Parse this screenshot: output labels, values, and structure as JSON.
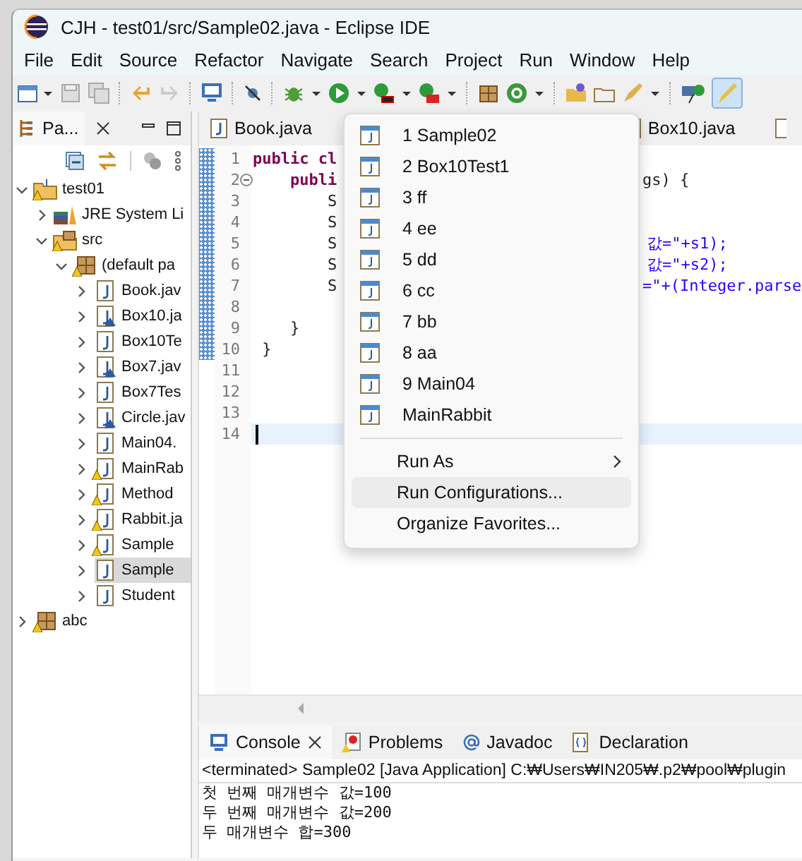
{
  "window": {
    "title": "CJH - test01/src/Sample02.java - Eclipse IDE"
  },
  "menu_bar": [
    "File",
    "Edit",
    "Source",
    "Refactor",
    "Navigate",
    "Search",
    "Project",
    "Run",
    "Window",
    "Help"
  ],
  "explorer": {
    "tab": "Pa...",
    "tree": [
      {
        "label": "test01",
        "kind": "project",
        "expanded": true,
        "warning": true,
        "selected": false,
        "children": [
          {
            "label": "JRE System Li",
            "kind": "library",
            "expanded": false,
            "warning": false,
            "selected": false
          },
          {
            "label": "src",
            "kind": "source",
            "expanded": true,
            "warning": true,
            "selected": false,
            "children": [
              {
                "label": "(default pa",
                "kind": "package",
                "expanded": true,
                "warning": true,
                "selected": false,
                "children": [
                  {
                    "label": "Book.jav",
                    "kind": "java",
                    "expanded": false,
                    "warning": false,
                    "main": false,
                    "selected": false
                  },
                  {
                    "label": "Box10.ja",
                    "kind": "java",
                    "expanded": false,
                    "warning": false,
                    "main": true,
                    "selected": false
                  },
                  {
                    "label": "Box10Te",
                    "kind": "java",
                    "expanded": false,
                    "warning": false,
                    "main": false,
                    "selected": false
                  },
                  {
                    "label": "Box7.jav",
                    "kind": "java",
                    "expanded": false,
                    "warning": false,
                    "main": true,
                    "selected": false
                  },
                  {
                    "label": "Box7Tes",
                    "kind": "java",
                    "expanded": false,
                    "warning": false,
                    "main": false,
                    "selected": false
                  },
                  {
                    "label": "Circle.jav",
                    "kind": "java",
                    "expanded": false,
                    "warning": false,
                    "main": true,
                    "selected": false
                  },
                  {
                    "label": "Main04.",
                    "kind": "java",
                    "expanded": false,
                    "warning": false,
                    "main": false,
                    "selected": false
                  },
                  {
                    "label": "MainRab",
                    "kind": "java",
                    "expanded": false,
                    "warning": true,
                    "main": false,
                    "selected": false
                  },
                  {
                    "label": "Method",
                    "kind": "java",
                    "expanded": false,
                    "warning": true,
                    "main": false,
                    "selected": false
                  },
                  {
                    "label": "Rabbit.ja",
                    "kind": "java",
                    "expanded": false,
                    "warning": true,
                    "main": false,
                    "selected": false
                  },
                  {
                    "label": "Sample",
                    "kind": "java",
                    "expanded": false,
                    "warning": true,
                    "main": false,
                    "selected": false
                  },
                  {
                    "label": "Sample",
                    "kind": "java",
                    "expanded": false,
                    "warning": false,
                    "main": false,
                    "selected": true
                  },
                  {
                    "label": "Student",
                    "kind": "java",
                    "expanded": false,
                    "warning": false,
                    "main": false,
                    "selected": false
                  }
                ]
              }
            ]
          }
        ]
      },
      {
        "label": "abc",
        "kind": "package",
        "expanded": false,
        "warning": true,
        "selected": false
      }
    ]
  },
  "editor": {
    "tabs": [
      "Book.java",
      "Box10.java"
    ],
    "lines": [
      {
        "number": "1",
        "code": "public cl"
      },
      {
        "number": "2",
        "code": "    publi",
        "rest": "gs) {",
        "fold": true
      },
      {
        "number": "3",
        "code": "        S"
      },
      {
        "number": "4",
        "code": "        S"
      },
      {
        "number": "5",
        "code": "        S",
        "rest": "값=\"+s1);"
      },
      {
        "number": "6",
        "code": "        S",
        "rest": "값=\"+s2);"
      },
      {
        "number": "7",
        "code": "        S",
        "rest": "=\"+(Integer.parse"
      },
      {
        "number": "8"
      },
      {
        "number": "9",
        "code": "    }"
      },
      {
        "number": "10",
        "code": " }"
      },
      {
        "number": "11"
      },
      {
        "number": "12"
      },
      {
        "number": "13"
      },
      {
        "number": "14",
        "current": true
      }
    ]
  },
  "run_menu": [
    {
      "kind": "launch",
      "label": "1 Sample02"
    },
    {
      "kind": "launch",
      "label": "2 Box10Test1"
    },
    {
      "kind": "launch",
      "label": "3 ff"
    },
    {
      "kind": "launch",
      "label": "4 ee"
    },
    {
      "kind": "launch",
      "label": "5 dd"
    },
    {
      "kind": "launch",
      "label": "6 cc"
    },
    {
      "kind": "launch",
      "label": "7 bb"
    },
    {
      "kind": "launch",
      "label": "8 aa"
    },
    {
      "kind": "launch",
      "label": "9 Main04"
    },
    {
      "kind": "launch",
      "label": "MainRabbit"
    },
    {
      "kind": "action",
      "label": "Run As",
      "submenu": true,
      "selected": false
    },
    {
      "kind": "action",
      "label": "Run Configurations...",
      "submenu": false,
      "selected": true
    },
    {
      "kind": "action",
      "label": "Organize Favorites...",
      "submenu": false,
      "selected": false
    }
  ],
  "console": {
    "tabs": [
      {
        "label": "Console",
        "kind": "console",
        "selected": true
      },
      {
        "label": "Problems",
        "kind": "problems",
        "selected": false
      },
      {
        "label": "Javadoc",
        "kind": "javadoc",
        "selected": false
      },
      {
        "label": "Declaration",
        "kind": "declaration",
        "selected": false
      }
    ],
    "status": "<terminated> Sample02 [Java Application] C:₩Users₩IN205₩.p2₩pool₩plugin",
    "output": [
      "첫 번째 매개변수 값=100",
      "두 번째 매개변수 값=200",
      "두 매개변수 합=300"
    ]
  }
}
